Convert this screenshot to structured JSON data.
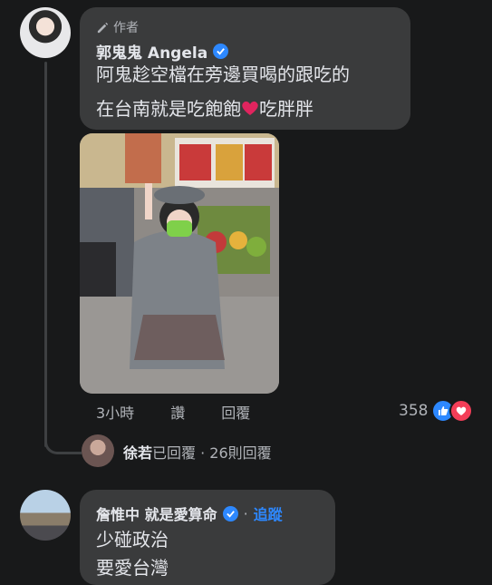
{
  "comment1": {
    "author_tag": "作者",
    "name": "郭鬼鬼 Angela",
    "line1": "阿鬼趁空檔在旁邊買喝的跟吃的",
    "line2a": "在台南就是吃飽飽",
    "line2b": "吃胖胖",
    "time": "3小時",
    "action_like": "讚",
    "action_reply": "回覆",
    "reaction_count": "358"
  },
  "reply_summary": {
    "name": "徐若",
    "text": "已回覆 · 26則回覆"
  },
  "comment2": {
    "name": "詹惟中 就是愛算命",
    "separator": "·",
    "follow": "追蹤",
    "line1": "少碰政治",
    "line2": "要愛台灣"
  },
  "colors": {
    "background": "#18191a",
    "bubble": "#3a3b3c",
    "accent": "#2d88ff",
    "love": "#f33e58"
  }
}
